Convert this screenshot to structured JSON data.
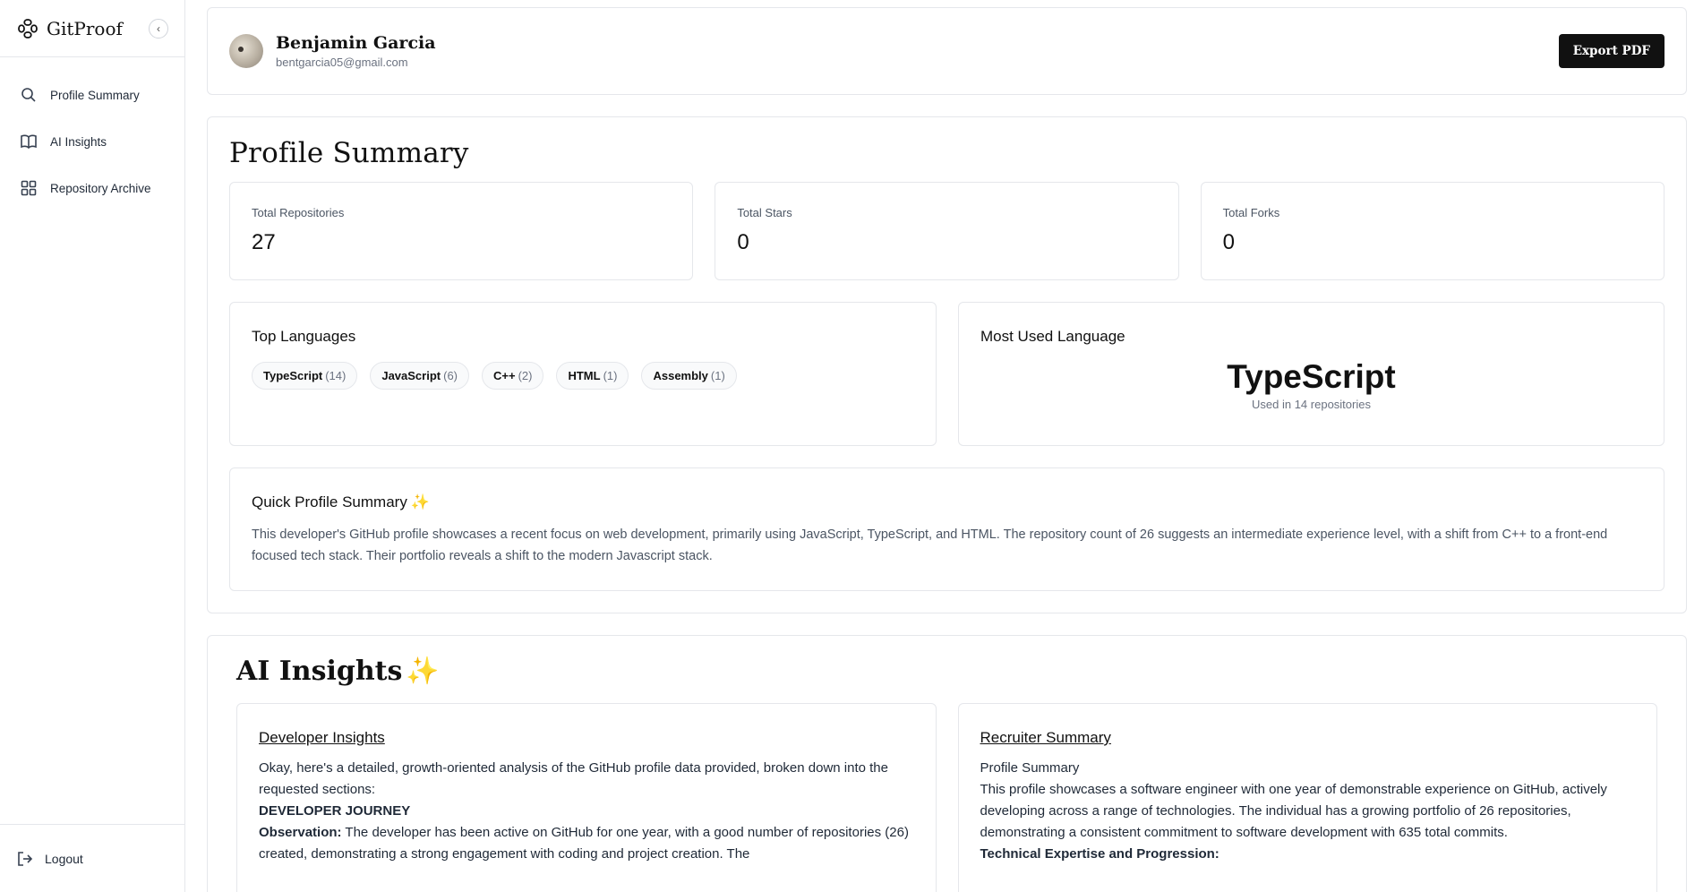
{
  "brand": {
    "name": "GitProof",
    "collapse_icon": "chevron-left"
  },
  "sidebar": {
    "items": [
      {
        "label": "Profile Summary",
        "icon": "search-icon"
      },
      {
        "label": "AI Insights",
        "icon": "book-icon"
      },
      {
        "label": "Repository Archive",
        "icon": "grid-icon"
      }
    ],
    "logout": "Logout"
  },
  "profile": {
    "name": "Benjamin Garcia",
    "email": "bentgarcia05@gmail.com",
    "export_label": "Export PDF"
  },
  "summary": {
    "title": "Profile Summary",
    "stats": [
      {
        "label": "Total Repositories",
        "value": "27"
      },
      {
        "label": "Total Stars",
        "value": "0"
      },
      {
        "label": "Total Forks",
        "value": "0"
      }
    ],
    "top_languages": {
      "title": "Top Languages",
      "chips": [
        {
          "name": "TypeScript",
          "count": "(14)"
        },
        {
          "name": "JavaScript",
          "count": "(6)"
        },
        {
          "name": "C++",
          "count": "(2)"
        },
        {
          "name": "HTML",
          "count": "(1)"
        },
        {
          "name": "Assembly",
          "count": "(1)"
        }
      ]
    },
    "most_used": {
      "title": "Most Used Language",
      "language": "TypeScript",
      "subtitle": "Used in 14 repositories"
    },
    "quick": {
      "title": "Quick Profile Summary",
      "sparkle": "✨",
      "text": "This developer's GitHub profile showcases a recent focus on web development, primarily using JavaScript, TypeScript, and HTML. The repository count of 26 suggests an intermediate experience level, with a shift from C++ to a front-end focused tech stack. Their portfolio reveals a shift to the modern Javascript stack."
    }
  },
  "insights": {
    "title": "AI Insights",
    "sparkle": "✨",
    "developer": {
      "title": "Developer Insights",
      "intro": "Okay, here's a detailed, growth-oriented analysis of the GitHub profile data provided, broken down into the requested sections:",
      "heading": "DEVELOPER JOURNEY",
      "obs_label": "Observation:",
      "obs_text": " The developer has been active on GitHub for one year, with a good number of repositories (26) created, demonstrating a strong engagement with coding and project creation. The"
    },
    "recruiter": {
      "title": "Recruiter Summary",
      "subheading": "Profile Summary",
      "text": "This profile showcases a software engineer with one year of demonstrable experience on GitHub, actively developing across a range of technologies. The individual has a growing portfolio of 26 repositories, demonstrating a consistent commitment to software development with 635 total commits.",
      "heading": "Technical Expertise and Progression:"
    }
  },
  "colors": {
    "accent": "#111111",
    "border": "#e5e7eb",
    "muted": "#6b7280",
    "sparkle": "#f59e0b"
  }
}
